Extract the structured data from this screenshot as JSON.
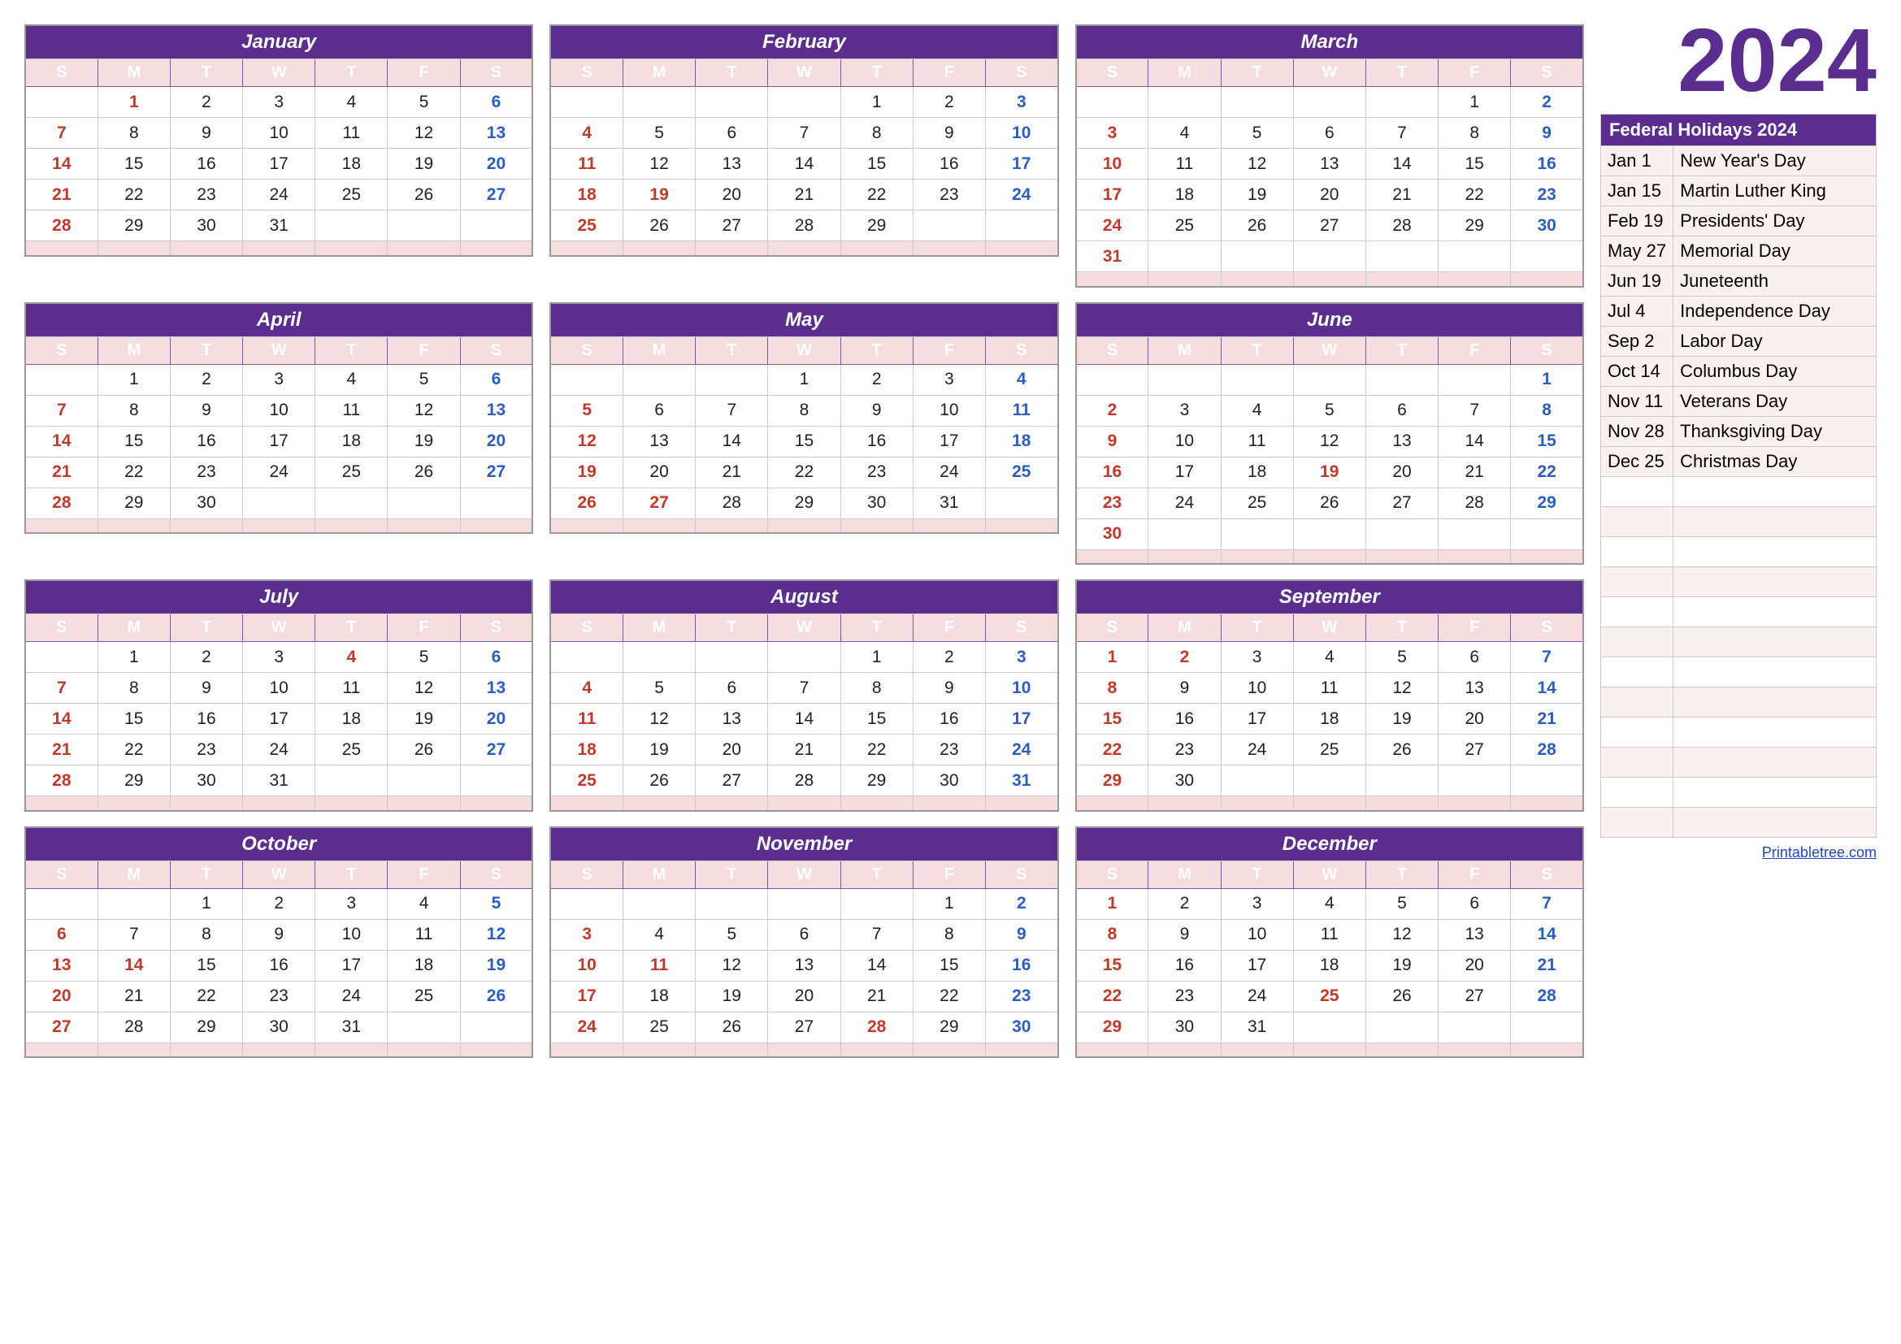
{
  "year": "2024",
  "sidebar": {
    "year_label": "2024",
    "holidays_header": "Federal Holidays 2024",
    "holidays": [
      {
        "date": "Jan 1",
        "name": "New Year's Day"
      },
      {
        "date": "Jan 15",
        "name": "Martin Luther King"
      },
      {
        "date": "Feb 19",
        "name": "Presidents' Day"
      },
      {
        "date": "May 27",
        "name": "Memorial Day"
      },
      {
        "date": "Jun 19",
        "name": "Juneteenth"
      },
      {
        "date": "Jul 4",
        "name": "Independence Day"
      },
      {
        "date": "Sep 2",
        "name": "Labor Day"
      },
      {
        "date": "Oct 14",
        "name": "Columbus Day"
      },
      {
        "date": "Nov 11",
        "name": "Veterans Day"
      },
      {
        "date": "Nov 28",
        "name": "Thanksgiving Day"
      },
      {
        "date": "Dec 25",
        "name": "Christmas Day"
      }
    ],
    "printable_label": "Printabletree.com"
  },
  "months": [
    {
      "name": "January",
      "weeks": [
        [
          "",
          "1",
          "2",
          "3",
          "4",
          "5",
          "6"
        ],
        [
          "7",
          "8",
          "9",
          "10",
          "11",
          "12",
          "13"
        ],
        [
          "14",
          "15",
          "16",
          "17",
          "18",
          "19",
          "20"
        ],
        [
          "21",
          "22",
          "23",
          "24",
          "25",
          "26",
          "27"
        ],
        [
          "28",
          "29",
          "30",
          "31",
          "",
          "",
          ""
        ]
      ],
      "sundays": [
        7,
        14,
        21,
        28
      ],
      "saturdays": [
        6,
        13,
        20,
        27
      ],
      "holidays": [
        1
      ]
    },
    {
      "name": "February",
      "weeks": [
        [
          "",
          "",
          "",
          "",
          "1",
          "2",
          "3"
        ],
        [
          "4",
          "5",
          "6",
          "7",
          "8",
          "9",
          "10"
        ],
        [
          "11",
          "12",
          "13",
          "14",
          "15",
          "16",
          "17"
        ],
        [
          "18",
          "19",
          "20",
          "21",
          "22",
          "23",
          "24"
        ],
        [
          "25",
          "26",
          "27",
          "28",
          "29",
          "",
          ""
        ]
      ],
      "sundays": [
        4,
        11,
        18,
        25
      ],
      "saturdays": [
        3,
        10,
        17,
        24
      ],
      "holidays": [
        19
      ]
    },
    {
      "name": "March",
      "weeks": [
        [
          "",
          "",
          "",
          "",
          "",
          "1",
          "2"
        ],
        [
          "3",
          "4",
          "5",
          "6",
          "7",
          "8",
          "9"
        ],
        [
          "10",
          "11",
          "12",
          "13",
          "14",
          "15",
          "16"
        ],
        [
          "17",
          "18",
          "19",
          "20",
          "21",
          "22",
          "23"
        ],
        [
          "24",
          "25",
          "26",
          "27",
          "28",
          "29",
          "30"
        ],
        [
          "31",
          "",
          "",
          "",
          "",
          "",
          ""
        ]
      ],
      "sundays": [
        3,
        10,
        17,
        24,
        31
      ],
      "saturdays": [
        2,
        9,
        16,
        23,
        30
      ],
      "holidays": []
    },
    {
      "name": "April",
      "weeks": [
        [
          "",
          "1",
          "2",
          "3",
          "4",
          "5",
          "6"
        ],
        [
          "7",
          "8",
          "9",
          "10",
          "11",
          "12",
          "13"
        ],
        [
          "14",
          "15",
          "16",
          "17",
          "18",
          "19",
          "20"
        ],
        [
          "21",
          "22",
          "23",
          "24",
          "25",
          "26",
          "27"
        ],
        [
          "28",
          "29",
          "30",
          "",
          "",
          "",
          ""
        ]
      ],
      "sundays": [
        7,
        14,
        21,
        28
      ],
      "saturdays": [
        6,
        13,
        20,
        27
      ],
      "holidays": []
    },
    {
      "name": "May",
      "weeks": [
        [
          "",
          "",
          "",
          "1",
          "2",
          "3",
          "4"
        ],
        [
          "5",
          "6",
          "7",
          "8",
          "9",
          "10",
          "11"
        ],
        [
          "12",
          "13",
          "14",
          "15",
          "16",
          "17",
          "18"
        ],
        [
          "19",
          "20",
          "21",
          "22",
          "23",
          "24",
          "25"
        ],
        [
          "26",
          "27",
          "28",
          "29",
          "30",
          "31",
          ""
        ]
      ],
      "sundays": [
        5,
        12,
        19,
        26
      ],
      "saturdays": [
        4,
        11,
        18,
        25
      ],
      "holidays": [
        27
      ]
    },
    {
      "name": "June",
      "weeks": [
        [
          "",
          "",
          "",
          "",
          "",
          "",
          "1"
        ],
        [
          "2",
          "3",
          "4",
          "5",
          "6",
          "7",
          "8"
        ],
        [
          "9",
          "10",
          "11",
          "12",
          "13",
          "14",
          "15"
        ],
        [
          "16",
          "17",
          "18",
          "19",
          "20",
          "21",
          "22"
        ],
        [
          "23",
          "24",
          "25",
          "26",
          "27",
          "28",
          "29"
        ],
        [
          "30",
          "",
          "",
          "",
          "",
          "",
          ""
        ]
      ],
      "sundays": [
        2,
        9,
        16,
        23,
        30
      ],
      "saturdays": [
        1,
        8,
        15,
        22,
        29
      ],
      "holidays": [
        19
      ]
    },
    {
      "name": "July",
      "weeks": [
        [
          "",
          "1",
          "2",
          "3",
          "4",
          "5",
          "6"
        ],
        [
          "7",
          "8",
          "9",
          "10",
          "11",
          "12",
          "13"
        ],
        [
          "14",
          "15",
          "16",
          "17",
          "18",
          "19",
          "20"
        ],
        [
          "21",
          "22",
          "23",
          "24",
          "25",
          "26",
          "27"
        ],
        [
          "28",
          "29",
          "30",
          "31",
          "",
          "",
          ""
        ]
      ],
      "sundays": [
        7,
        14,
        21,
        28
      ],
      "saturdays": [
        6,
        13,
        20,
        27
      ],
      "holidays": [
        4
      ]
    },
    {
      "name": "August",
      "weeks": [
        [
          "",
          "",
          "",
          "",
          "1",
          "2",
          "3"
        ],
        [
          "4",
          "5",
          "6",
          "7",
          "8",
          "9",
          "10"
        ],
        [
          "11",
          "12",
          "13",
          "14",
          "15",
          "16",
          "17"
        ],
        [
          "18",
          "19",
          "20",
          "21",
          "22",
          "23",
          "24"
        ],
        [
          "25",
          "26",
          "27",
          "28",
          "29",
          "30",
          "31"
        ]
      ],
      "sundays": [
        4,
        11,
        18,
        25
      ],
      "saturdays": [
        3,
        10,
        17,
        24,
        31
      ],
      "holidays": []
    },
    {
      "name": "September",
      "weeks": [
        [
          "1",
          "2",
          "3",
          "4",
          "5",
          "6",
          "7"
        ],
        [
          "8",
          "9",
          "10",
          "11",
          "12",
          "13",
          "14"
        ],
        [
          "15",
          "16",
          "17",
          "18",
          "19",
          "20",
          "21"
        ],
        [
          "22",
          "23",
          "24",
          "25",
          "26",
          "27",
          "28"
        ],
        [
          "29",
          "30",
          "",
          "",
          "",
          "",
          ""
        ]
      ],
      "sundays": [
        1,
        8,
        15,
        22,
        29
      ],
      "saturdays": [
        7,
        14,
        21,
        28
      ],
      "holidays": [
        2
      ]
    },
    {
      "name": "October",
      "weeks": [
        [
          "",
          "",
          "1",
          "2",
          "3",
          "4",
          "5"
        ],
        [
          "6",
          "7",
          "8",
          "9",
          "10",
          "11",
          "12"
        ],
        [
          "13",
          "14",
          "15",
          "16",
          "17",
          "18",
          "19"
        ],
        [
          "20",
          "21",
          "22",
          "23",
          "24",
          "25",
          "26"
        ],
        [
          "27",
          "28",
          "29",
          "30",
          "31",
          "",
          ""
        ]
      ],
      "sundays": [
        6,
        13,
        20,
        27
      ],
      "saturdays": [
        5,
        12,
        19,
        26
      ],
      "holidays": [
        14
      ]
    },
    {
      "name": "November",
      "weeks": [
        [
          "",
          "",
          "",
          "",
          "",
          "1",
          "2"
        ],
        [
          "3",
          "4",
          "5",
          "6",
          "7",
          "8",
          "9"
        ],
        [
          "10",
          "11",
          "12",
          "13",
          "14",
          "15",
          "16"
        ],
        [
          "17",
          "18",
          "19",
          "20",
          "21",
          "22",
          "23"
        ],
        [
          "24",
          "25",
          "26",
          "27",
          "28",
          "29",
          "30"
        ]
      ],
      "sundays": [
        3,
        10,
        17,
        24
      ],
      "saturdays": [
        2,
        9,
        16,
        23,
        30
      ],
      "holidays": [
        11,
        28
      ]
    },
    {
      "name": "December",
      "weeks": [
        [
          "1",
          "2",
          "3",
          "4",
          "5",
          "6",
          "7"
        ],
        [
          "8",
          "9",
          "10",
          "11",
          "12",
          "13",
          "14"
        ],
        [
          "15",
          "16",
          "17",
          "18",
          "19",
          "20",
          "21"
        ],
        [
          "22",
          "23",
          "24",
          "25",
          "26",
          "27",
          "28"
        ],
        [
          "29",
          "30",
          "31",
          "",
          "",
          "",
          ""
        ]
      ],
      "sundays": [
        1,
        8,
        15,
        22,
        29
      ],
      "saturdays": [
        7,
        14,
        21,
        28
      ],
      "holidays": [
        25
      ]
    }
  ],
  "dow_labels": [
    "S",
    "M",
    "T",
    "W",
    "T",
    "F",
    "S"
  ]
}
